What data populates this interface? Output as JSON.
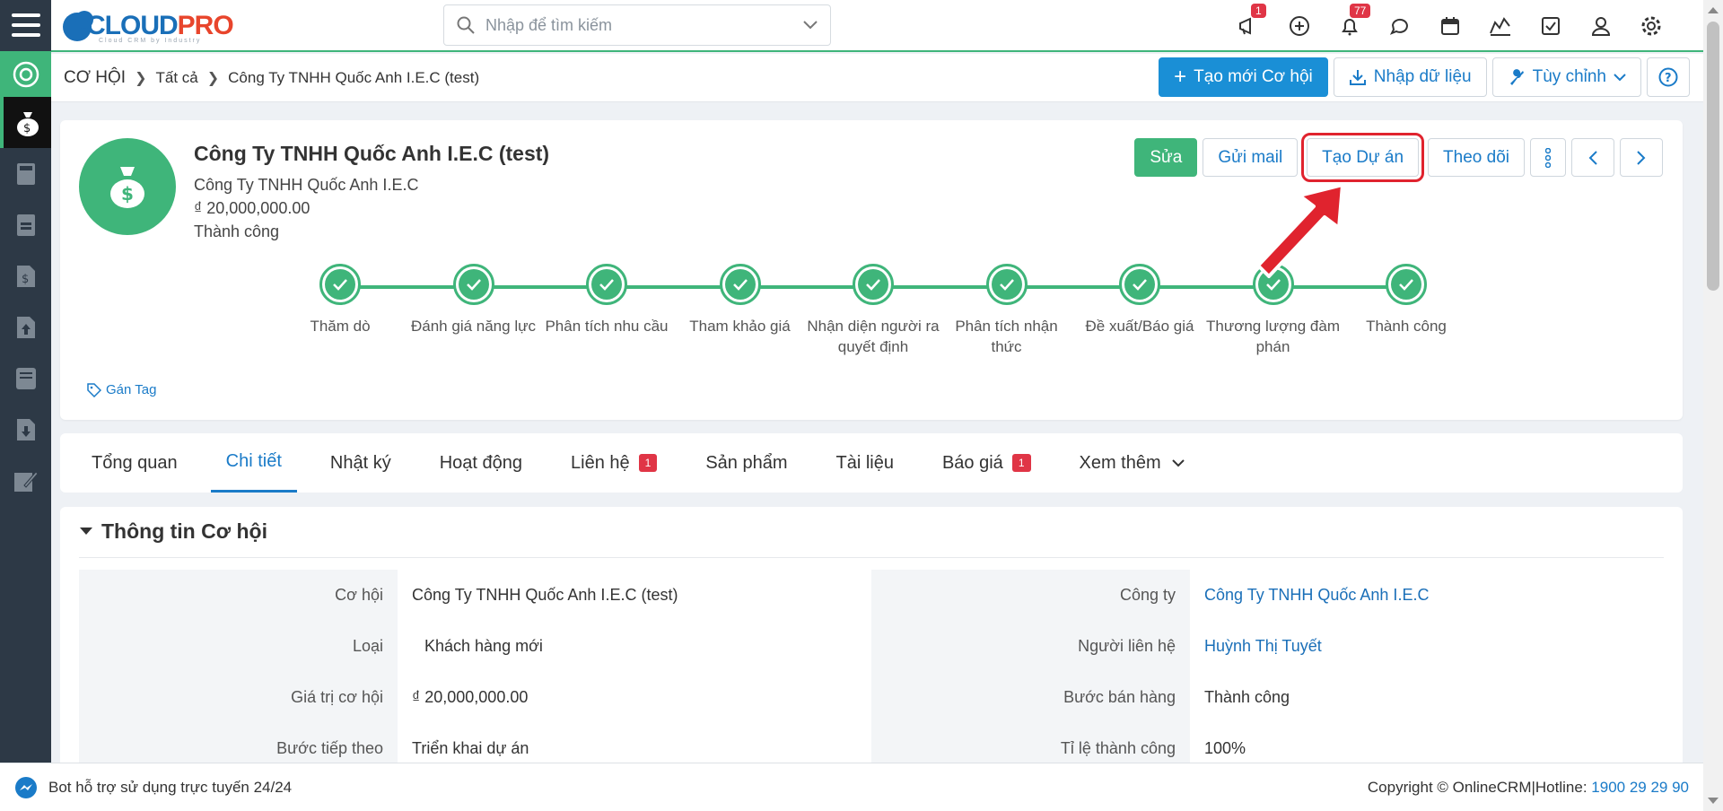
{
  "app": {
    "logo_main": "CLOUD",
    "logo_accent": "PRO",
    "logo_sub": "Cloud CRM by Industry"
  },
  "search": {
    "placeholder": "Nhập để tìm kiếm"
  },
  "topbar": {
    "announcement_badge": "1",
    "notification_badge": "77"
  },
  "breadcrumb": {
    "root": "CƠ HỘI",
    "level1": "Tất cả",
    "level2": "Công Ty TNHH Quốc Anh I.E.C (test)"
  },
  "header_actions": {
    "create": "Tạo mới Cơ hội",
    "import": "Nhập dữ liệu",
    "customize": "Tùy chỉnh"
  },
  "record": {
    "title": "Công Ty TNHH Quốc Anh I.E.C (test)",
    "company": "Công Ty TNHH Quốc Anh I.E.C",
    "amount": "₫ 20,000,000.00",
    "status": "Thành công",
    "tag_label": "Gán Tag"
  },
  "record_actions": {
    "edit": "Sửa",
    "send_mail": "Gửi mail",
    "create_project": "Tạo Dự án",
    "follow": "Theo dõi"
  },
  "stages": [
    {
      "label": "Thăm dò"
    },
    {
      "label": "Đánh giá năng lực"
    },
    {
      "label": "Phân tích nhu cầu"
    },
    {
      "label": "Tham khảo giá"
    },
    {
      "label": "Nhận diện người ra quyết định"
    },
    {
      "label": "Phân tích nhận thức"
    },
    {
      "label": "Đề xuất/Báo giá"
    },
    {
      "label": "Thương lượng đàm phán"
    },
    {
      "label": "Thành công"
    }
  ],
  "tabs": [
    {
      "label": "Tổng quan",
      "count": ""
    },
    {
      "label": "Chi tiết",
      "count": ""
    },
    {
      "label": "Nhật ký",
      "count": ""
    },
    {
      "label": "Hoạt động",
      "count": ""
    },
    {
      "label": "Liên hệ",
      "count": "1"
    },
    {
      "label": "Sản phẩm",
      "count": ""
    },
    {
      "label": "Tài liệu",
      "count": ""
    },
    {
      "label": "Báo giá",
      "count": "1"
    },
    {
      "label": "Xem thêm",
      "count": ""
    }
  ],
  "section": {
    "title": "Thông tin Cơ hội",
    "left": [
      {
        "key": "Cơ hội",
        "value": "Công Ty TNHH Quốc Anh I.E.C (test)"
      },
      {
        "key": "Loại",
        "value": "Khách hàng mới"
      },
      {
        "key": "Giá trị cơ hội",
        "value": "₫ 20,000,000.00"
      },
      {
        "key": "Bước tiếp theo",
        "value": "Triển khai dự án"
      }
    ],
    "right": [
      {
        "key": "Công ty",
        "value": "Công Ty TNHH Quốc Anh I.E.C"
      },
      {
        "key": "Người liên hệ",
        "value": "Huỳnh Thị Tuyết"
      },
      {
        "key": "Bước bán hàng",
        "value": "Thành công"
      },
      {
        "key": "Tỉ lệ thành công",
        "value": "100%"
      }
    ]
  },
  "footer": {
    "bot": "Bot hỗ trợ sử dụng trực tuyến 24/24",
    "copyright": "Copyright © OnlineCRM|Hotline: ",
    "hotline": "1900 29 29 90"
  },
  "colors": {
    "accent_green": "#3fb57a",
    "primary_blue": "#1a8fd6",
    "sidebar": "#2d3946",
    "highlight_red": "#e0232e"
  }
}
